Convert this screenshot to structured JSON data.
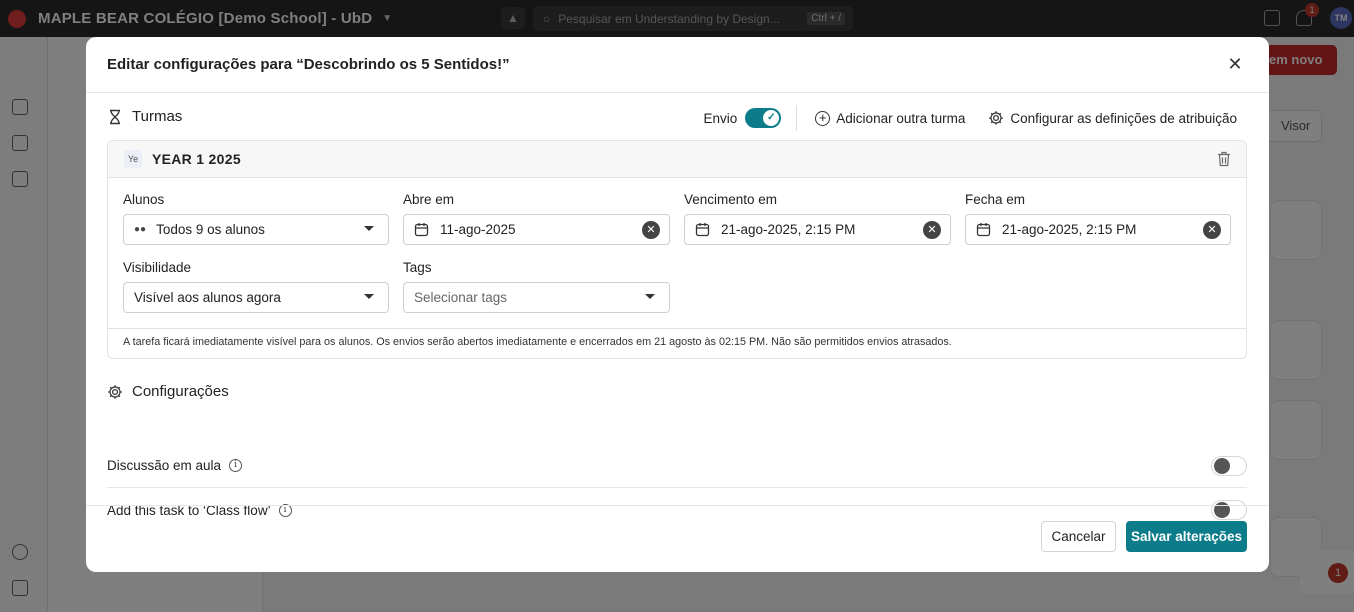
{
  "app": {
    "title": "MAPLE BEAR COLÉGIO [Demo School] - UbD",
    "search_placeholder": "Pesquisar em Understanding by Design...",
    "search_shortcut": "Ctrl + /",
    "notification_count": "1",
    "user_initials": "TM",
    "new_button_label": "em novo",
    "visor_label": "Visor",
    "floating_badge": "1"
  },
  "modal": {
    "title": "Editar configurações para “Descobrindo os 5 Sentidos!”",
    "turmas": {
      "heading": "Turmas",
      "envio_label": "Envio",
      "envio_on": true,
      "add_class_label": "Adicionar outra turma",
      "config_label": "Configurar as definições de atribuição",
      "class": {
        "chip": "Ye",
        "name": "YEAR 1 2025",
        "alunos_label": "Alunos",
        "alunos_value": "Todos 9 os alunos",
        "abre_label": "Abre em",
        "abre_value": "11-ago-2025",
        "vencimento_label": "Vencimento em",
        "vencimento_value": "21-ago-2025, 2:15 PM",
        "fecha_label": "Fecha em",
        "fecha_value": "21-ago-2025, 2:15 PM",
        "visibilidade_label": "Visibilidade",
        "visibilidade_value": "Visível aos alunos agora",
        "tags_label": "Tags",
        "tags_placeholder": "Selecionar tags",
        "summary": "A tarefa ficará imediatamente visível para os alunos. Os envios serão abertos imediatamente e encerrados em 21 agosto às 02:15 PM. Não são permitidos envios atrasados."
      }
    },
    "configuracoes": {
      "heading": "Configurações",
      "settings": [
        {
          "label": "Discussão em aula",
          "enabled": false
        },
        {
          "label": "Add this task to ‘Class flow’",
          "enabled": false
        }
      ]
    },
    "cancel_label": "Cancelar",
    "save_label": "Salvar alterações"
  },
  "colors": {
    "accent": "#0c7b8a",
    "brand_red": "#c62828",
    "topbar": "#2b2b2b"
  }
}
